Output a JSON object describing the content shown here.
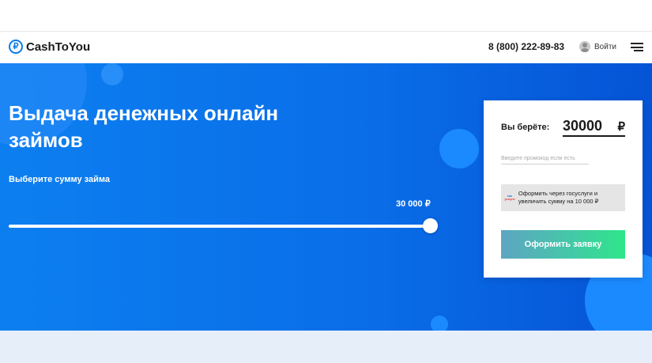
{
  "header": {
    "logo_icon": "ruble-circle-icon",
    "logo_glyph": "₽",
    "logo_text": "CashToYou",
    "phone": "8 (800) 222-89-83",
    "login_label": "Войти",
    "login_icon": "user-avatar-icon",
    "menu_icon": "hamburger-menu-icon"
  },
  "hero": {
    "title": "Выдача денежных онлайн займов",
    "sum_label": "Выберите сумму займа",
    "slider_value": "30 000 ₽",
    "slider_fraction": 1.0
  },
  "card": {
    "take_label": "Вы берёте:",
    "amount_value": "30000",
    "currency": "₽",
    "promo_placeholder": "Введите промокод если есть",
    "gosuslugi_logo_top": "гос",
    "gosuslugi_logo_bottom": "услуги",
    "gosuslugi_text": "Оформить через госуслуги и увеличить сумму на 10 000 ₽",
    "apply_label": "Оформить заявку"
  },
  "colors": {
    "accent": "#0c7be9",
    "hero_start": "#0c7ff0",
    "hero_end": "#0554d6",
    "apply_start": "#5ea5c2",
    "apply_end": "#2ee68a",
    "bottom_band": "#e6eef9"
  }
}
